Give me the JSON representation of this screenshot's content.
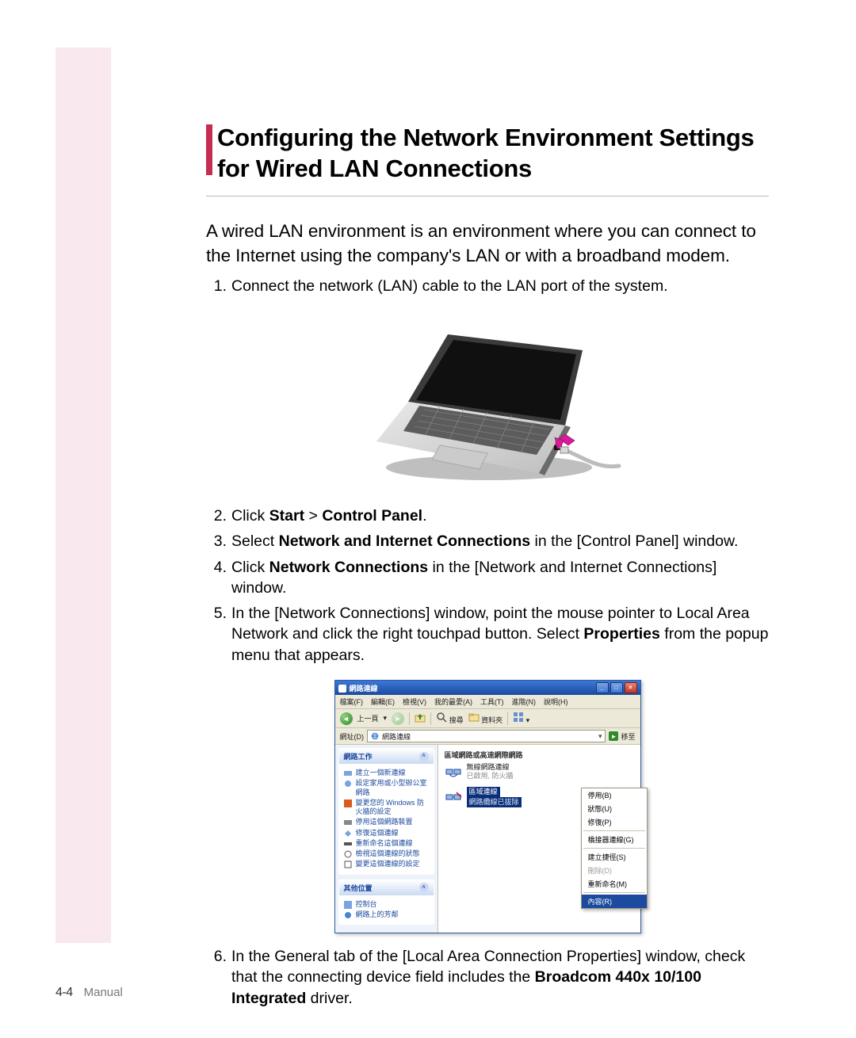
{
  "page": {
    "footer_page": "4-4",
    "footer_label": "Manual"
  },
  "heading": "Configuring the Network Environment Settings for Wired LAN Connections",
  "intro": "A wired LAN environment is an environment where you can connect to the Internet using the company's LAN or with a broadband modem.",
  "steps": {
    "s1": "Connect the network (LAN) cable to the LAN port of the system.",
    "s2_pre": "Click ",
    "s2_b1": "Start",
    "s2_mid": " > ",
    "s2_b2": "Control Panel",
    "s2_post": ".",
    "s3_pre": "Select ",
    "s3_b": "Network and Internet Connections",
    "s3_post": " in the [Control Panel] window.",
    "s4_pre": "Click ",
    "s4_b": "Network Connections",
    "s4_post": " in the [Network and Internet Connections] window.",
    "s5_pre": "In the [Network Connections] window, point the mouse pointer to Local Area Network and click the right touchpad button. Select ",
    "s5_b": "Properties",
    "s5_post": " from the popup menu that appears.",
    "s6_pre": "In the General tab of the [Local Area Connection Properties] window, check that the connecting device field includes the ",
    "s6_b": "Broadcom 440x 10/100 Integrated",
    "s6_post": " driver."
  },
  "win": {
    "title": "網路連線",
    "menu": {
      "file": "檔案(F)",
      "edit": "編輯(E)",
      "view": "檢視(V)",
      "fav": "我的最愛(A)",
      "tools": "工具(T)",
      "adv": "進階(N)",
      "help": "說明(H)"
    },
    "toolbar": {
      "back": "上一頁",
      "search": "搜尋",
      "folders": "資料夾"
    },
    "address": {
      "label": "網址(D)",
      "value": "網路連線",
      "go": "移至"
    },
    "left": {
      "tasks_title": "網路工作",
      "tasks": [
        "建立一個新連線",
        "設定家用或小型辦公室網路",
        "變更您的 Windows 防火牆的設定",
        "停用這個網路裝置",
        "修復這個連線",
        "重新命名這個連線",
        "檢視這個連線的狀態",
        "變更這個連線的設定"
      ],
      "other_title": "其他位置",
      "other": [
        "控制台",
        "網路上的芳鄰"
      ]
    },
    "right": {
      "header": "區域網路或高速網際網路",
      "wifi_name": "無線網路連線",
      "wifi_sub": "已啟用, 防火牆",
      "lan_name": "區域連線",
      "lan_sub": "網路纜線已拔除"
    },
    "ctx": {
      "disable": "停用(B)",
      "status": "狀態(U)",
      "repair": "修復(P)",
      "bridge": "橋接器連線(G)",
      "shortcut": "建立捷徑(S)",
      "delete": "刪除(D)",
      "rename": "重新命名(M)",
      "props": "內容(R)"
    }
  }
}
